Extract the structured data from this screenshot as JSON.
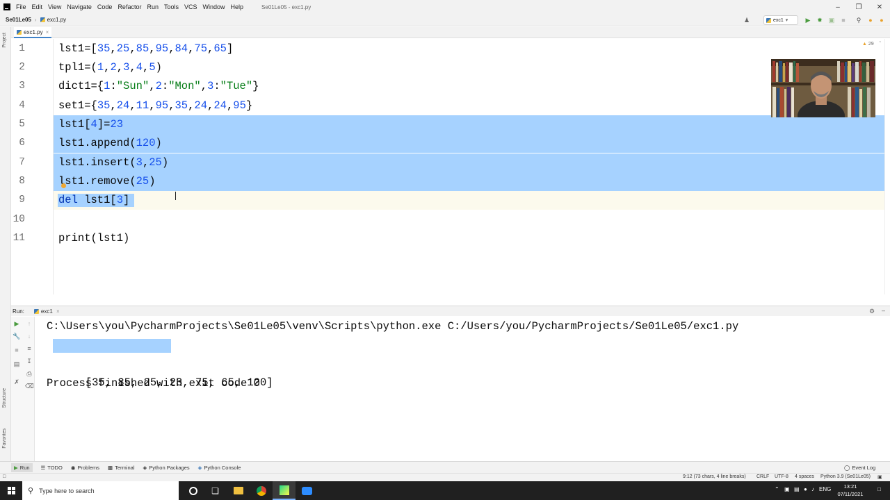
{
  "window": {
    "menu": [
      "File",
      "Edit",
      "View",
      "Navigate",
      "Code",
      "Refactor",
      "Run",
      "Tools",
      "VCS",
      "Window",
      "Help"
    ],
    "title": "Se01Le05 - exc1.py"
  },
  "navbar": {
    "project": "Se01Le05",
    "file": "exc1.py",
    "run_config": "exc1"
  },
  "tabs": [
    {
      "label": "exc1.py"
    }
  ],
  "side_tools": {
    "project": "Project",
    "structure": "Structure",
    "favorites": "Favorites"
  },
  "editor": {
    "inspection_count": "29",
    "lines": [
      {
        "n": "1",
        "code": "lst1=[35,25,85,95,84,75,65]"
      },
      {
        "n": "2",
        "code": "tpl1=(1,2,3,4,5)"
      },
      {
        "n": "3",
        "code": "dict1={1:\"Sun\",2:\"Mon\",3:\"Tue\"}"
      },
      {
        "n": "4",
        "code": "set1={35,24,11,95,35,24,24,95}"
      },
      {
        "n": "5",
        "code": "lst1[4]=23"
      },
      {
        "n": "6",
        "code": "lst1.append(120)"
      },
      {
        "n": "7",
        "code": "lst1.insert(3,25)"
      },
      {
        "n": "8",
        "code": "lst1.remove(25)"
      },
      {
        "n": "9",
        "code": "del lst1[3]"
      },
      {
        "n": "10",
        "code": ""
      },
      {
        "n": "11",
        "code": "print(lst1)"
      }
    ]
  },
  "run_panel": {
    "label": "Run:",
    "tab": "exc1",
    "output": [
      "C:\\Users\\you\\PycharmProjects\\Se01Le05\\venv\\Scripts\\python.exe C:/Users/you/PycharmProjects/Se01Le05/exc1.py",
      "[35, 85, 25, 23, 75, 65, 120]",
      "",
      "Process finished with exit code 0"
    ]
  },
  "tool_windows": [
    "Run",
    "TODO",
    "Problems",
    "Terminal",
    "Python Packages",
    "Python Console"
  ],
  "event_log": "Event Log",
  "status": {
    "position": "9:12 (73 chars, 4 line breaks)",
    "line_sep": "CRLF",
    "encoding": "UTF-8",
    "indent": "4 spaces",
    "interpreter": "Python 3.9 (Se01Le05)"
  },
  "taskbar": {
    "search_placeholder": "Type here to search",
    "lang": "ENG",
    "time": "13:21",
    "date": "07/11/2021"
  }
}
